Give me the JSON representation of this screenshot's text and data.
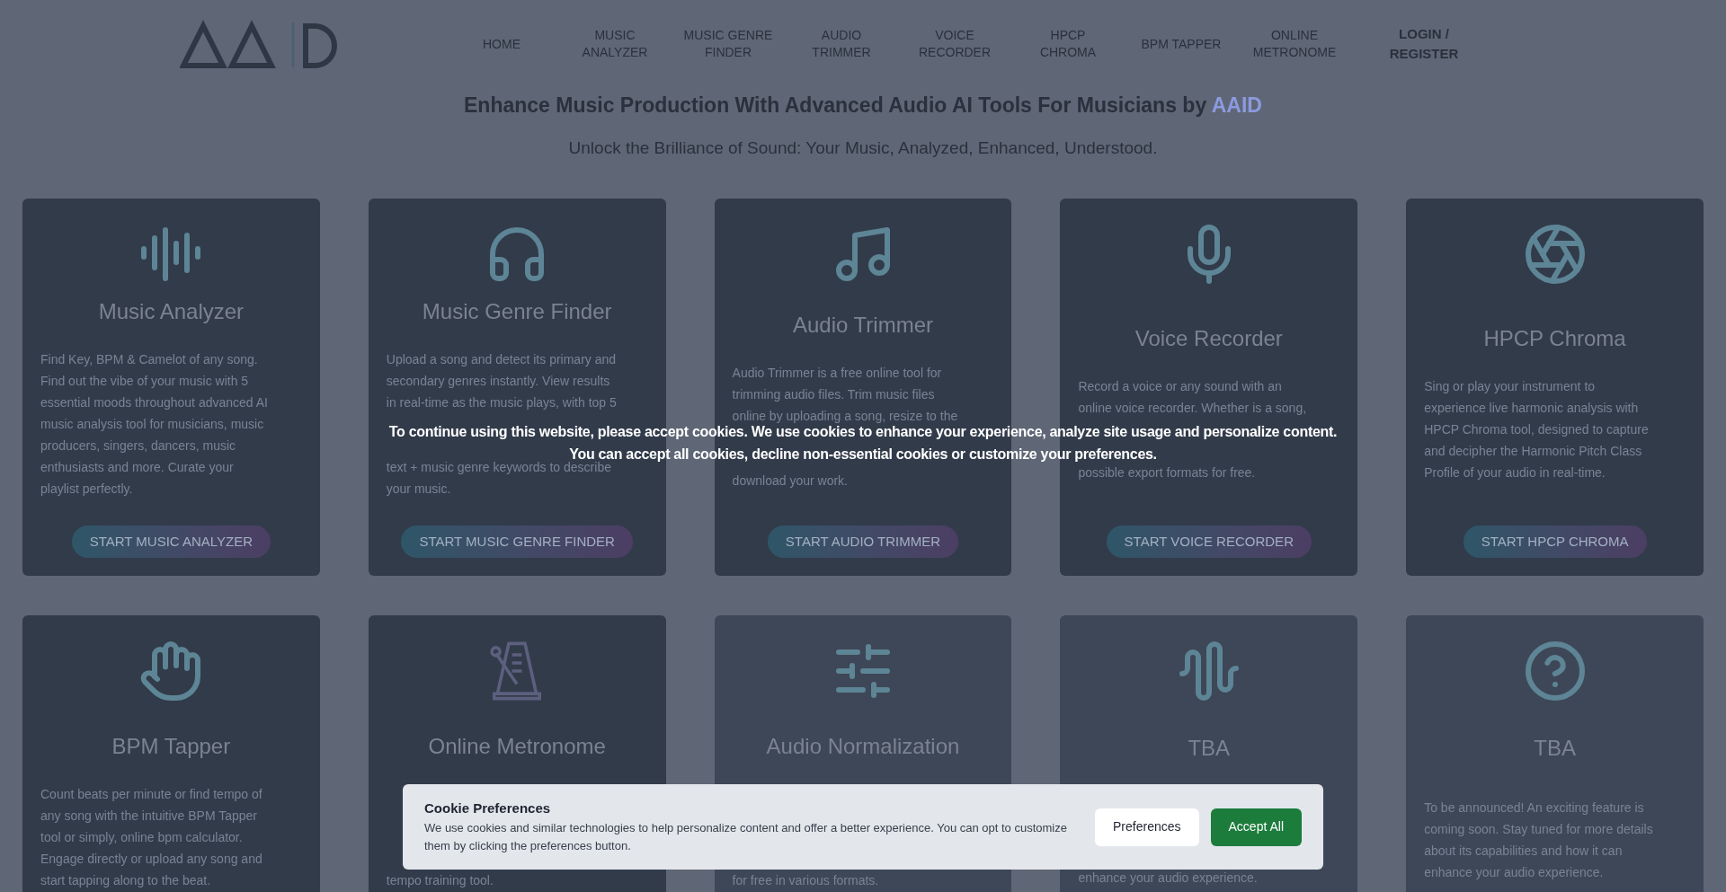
{
  "nav": {
    "items": [
      {
        "label": "HOME"
      },
      {
        "label": "MUSIC ANALYZER"
      },
      {
        "label": "MUSIC GENRE FINDER"
      },
      {
        "label": "AUDIO TRIMMER"
      },
      {
        "label": "VOICE RECORDER"
      },
      {
        "label": "HPCP CHROMA"
      },
      {
        "label": "BPM TAPPER"
      },
      {
        "label": "ONLINE METRONOME"
      }
    ],
    "login": "LOGIN / REGISTER"
  },
  "hero": {
    "headline": "Enhance Music Production With Advanced Audio AI Tools For Musicians by",
    "brand": "AAID",
    "subtitle": "Unlock the Brilliance of Sound: Your Music, Analyzed, Enhanced, Understood."
  },
  "cards": [
    {
      "title": "Music Analyzer",
      "description": [
        "Find Key, BPM & Camelot of any song.",
        "Find out the vibe of your music with 5",
        "essential moods throughout advanced AI",
        "music analysis tool for musicians, music",
        "producers, singers, dancers, music",
        "enthusiasts and more. Curate your",
        "playlist perfectly."
      ],
      "button": "START MUSIC ANALYZER"
    },
    {
      "title": "Music Genre Finder",
      "description": [
        "Upload a song and detect its primary and",
        "secondary genres instantly. View results",
        "in real-time as the music plays, with top 5"
      ],
      "description_after_cover": [
        "text + music genre keywords to describe",
        "your music."
      ],
      "button": "START MUSIC GENRE FINDER"
    },
    {
      "title": "Audio Trimmer",
      "description": [
        "Audio Trimmer is a free online tool for",
        "trimming audio files. Trim music files",
        "online by uploading a song, resize to the"
      ],
      "description_after_cover": [
        "download your work."
      ],
      "button": "START AUDIO TRIMMER"
    },
    {
      "title": "Voice Recorder",
      "description": [
        "Record a voice or any sound with an",
        "online voice recorder. Whether is a song,"
      ],
      "description_after_cover": [
        "possible export formats for free."
      ],
      "button": "START VOICE RECORDER"
    },
    {
      "title": "HPCP Chroma",
      "description": [
        "Sing or play your instrument to",
        "experience live harmonic analysis with",
        "HPCP Chroma tool, designed to capture",
        "and decipher the Harmonic Pitch Class",
        "Profile of your audio in real-time."
      ],
      "button": "START HPCP CHROMA"
    },
    {
      "title": "BPM Tapper",
      "description": [
        "Count beats per minute or find tempo of",
        "any song with the intuitive BPM Tapper",
        "tool or simply, online bpm calculator.",
        "Engage directly or upload any song and",
        "start tapping along to the beat."
      ]
    },
    {
      "title": "Online Metronome",
      "description_after_cover": [
        "tempo training tool."
      ]
    },
    {
      "title": "Audio Normalization",
      "description_after_cover": [
        "for free in various formats."
      ]
    },
    {
      "title": "TBA",
      "description_after_cover": [
        "enhance your audio experience."
      ]
    },
    {
      "title": "TBA",
      "description": [
        "To be announced! An exciting feature is",
        "coming soon. Stay tuned for more details",
        "about its capabilities and how it can",
        "enhance your audio experience."
      ]
    }
  ],
  "overlay_message": [
    "To continue using this website, please accept cookies. We use cookies to enhance your experience, analyze site usage and personalize content.",
    "You can accept all cookies, decline non-essential cookies or customize your preferences."
  ],
  "cookie_banner": {
    "title": "Cookie Preferences",
    "text": "We use cookies and similar technologies to help personalize content and offer a better experience. You can opt to customize them by clicking the preferences button.",
    "buttons": [
      {
        "label": "Preferences",
        "kind": "secondary"
      },
      {
        "label": "Accept All",
        "kind": "primary"
      }
    ]
  }
}
